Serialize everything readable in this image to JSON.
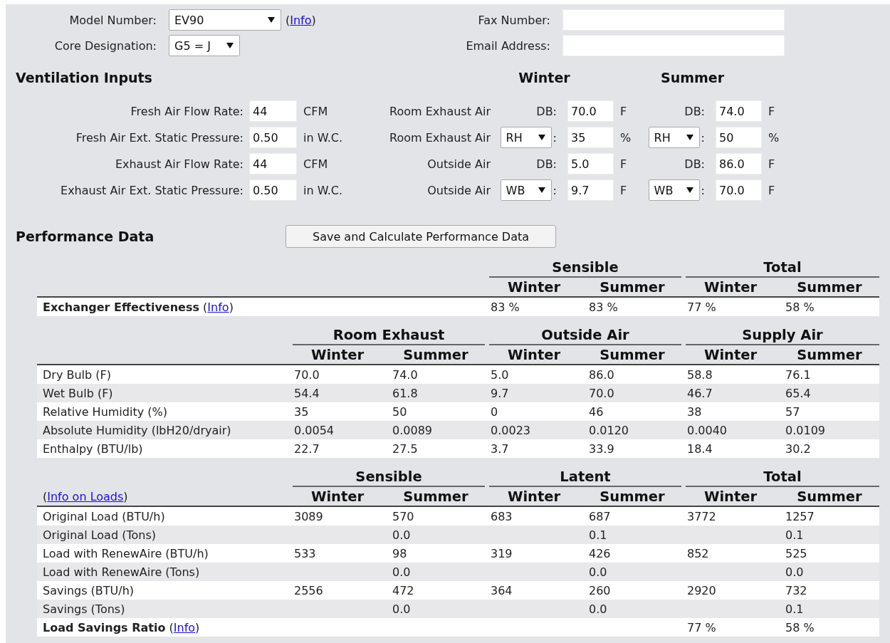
{
  "selection": {
    "model": {
      "label": "Model Number:",
      "value": "EV90",
      "info": {
        "prefix": "(",
        "text": "Info",
        "suffix": ")"
      }
    },
    "core": {
      "label": "Core Designation:",
      "value": "G5 = J"
    }
  },
  "contact": [
    {
      "label": "Fax Number:"
    },
    {
      "label": "Email Address:"
    }
  ],
  "ventilation": {
    "title": "Ventilation Inputs",
    "seasons": [
      "Winter",
      "Summer"
    ],
    "rows": [
      {
        "label": "Fresh Air Flow Rate:",
        "value": "44",
        "unit": "CFM",
        "air": "Room Exhaust Air",
        "winter": {
          "kind": "label",
          "text": "DB:",
          "value": "70.0",
          "unit": "F"
        },
        "summer": {
          "kind": "label",
          "text": "DB:",
          "value": "74.0",
          "unit": "F"
        }
      },
      {
        "label": "Fresh Air Ext. Static Pressure:",
        "value": "0.50",
        "unit": "in W.C.",
        "air": "Room Exhaust Air",
        "winter": {
          "kind": "select",
          "text": "RH",
          "suffix": ":",
          "value": "35",
          "unit": "%"
        },
        "summer": {
          "kind": "select",
          "text": "RH",
          "suffix": ":",
          "value": "50",
          "unit": "%"
        }
      },
      {
        "label": "Exhaust Air Flow Rate:",
        "value": "44",
        "unit": "CFM",
        "air": "Outside Air",
        "winter": {
          "kind": "label",
          "text": "DB:",
          "value": "5.0",
          "unit": "F"
        },
        "summer": {
          "kind": "label",
          "text": "DB:",
          "value": "86.0",
          "unit": "F"
        }
      },
      {
        "label": "Exhaust Air Ext. Static Pressure:",
        "value": "0.50",
        "unit": "in W.C.",
        "air": "Outside Air",
        "winter": {
          "kind": "select",
          "text": "WB",
          "suffix": ":",
          "value": "9.7",
          "unit": "F"
        },
        "summer": {
          "kind": "select",
          "text": "WB",
          "suffix": ":",
          "value": "70.0",
          "unit": "F"
        }
      }
    ]
  },
  "performance": {
    "title": "Performance Data",
    "button": "Save and Calculate Performance Data",
    "tables": [
      {
        "groups": [
          {
            "label": "Sensible",
            "columns": [
              "Winter",
              "Summer"
            ]
          },
          {
            "label": "Total",
            "columns": [
              "Winter",
              "Summer"
            ]
          }
        ],
        "rows": [
          {
            "label": "Exchanger Effectiveness",
            "bold": true,
            "info": {
              "prefix": "(",
              "text": "Info",
              "suffix": ")"
            },
            "values": [
              "83 %",
              "83 %",
              "77 %",
              "58 %"
            ]
          }
        ]
      },
      {
        "groups": [
          {
            "label": "Room Exhaust",
            "columns": [
              "Winter",
              "Summer"
            ]
          },
          {
            "label": "Outside Air",
            "columns": [
              "Winter",
              "Summer"
            ]
          },
          {
            "label": "Supply Air",
            "columns": [
              "Winter",
              "Summer"
            ]
          }
        ],
        "rows": [
          {
            "label": "Dry Bulb (F)",
            "bold": false,
            "values": [
              "70.0",
              "74.0",
              "5.0",
              "86.0",
              "58.8",
              "76.1"
            ]
          },
          {
            "label": "Wet Bulb (F)",
            "bold": false,
            "values": [
              "54.4",
              "61.8",
              "9.7",
              "70.0",
              "46.7",
              "65.4"
            ]
          },
          {
            "label": "Relative Humidity (%)",
            "bold": false,
            "values": [
              "35",
              "50",
              "0",
              "46",
              "38",
              "57"
            ]
          },
          {
            "label": "Absolute Humidity (lbH20/dryair)",
            "bold": false,
            "values": [
              "0.0054",
              "0.0089",
              "0.0023",
              "0.0120",
              "0.0040",
              "0.0109"
            ]
          },
          {
            "label": "Enthalpy (BTU/lb)",
            "bold": false,
            "values": [
              "22.7",
              "27.5",
              "3.7",
              "33.9",
              "18.4",
              "30.2"
            ]
          }
        ]
      },
      {
        "corner": {
          "prefix": "(",
          "text": "Info on Loads",
          "suffix": ")"
        },
        "groups": [
          {
            "label": "Sensible",
            "columns": [
              "Winter",
              "Summer"
            ]
          },
          {
            "label": "Latent",
            "columns": [
              "Winter",
              "Summer"
            ]
          },
          {
            "label": "Total",
            "columns": [
              "Winter",
              "Summer"
            ]
          }
        ],
        "rows": [
          {
            "label": "Original Load (BTU/h)",
            "bold": false,
            "values": [
              "3089",
              "570",
              "683",
              "687",
              "3772",
              "1257"
            ]
          },
          {
            "label": "Original Load (Tons)",
            "bold": false,
            "cells": [
              {
                "kind": "empty"
              },
              {
                "kind": "value",
                "text": "0.0"
              },
              {
                "kind": "empty"
              },
              {
                "kind": "value",
                "text": "0.1"
              },
              {
                "kind": "empty"
              },
              {
                "kind": "value",
                "text": "0.1"
              }
            ]
          },
          {
            "label": "Load with RenewAire (BTU/h)",
            "bold": false,
            "values": [
              "533",
              "98",
              "319",
              "426",
              "852",
              "525"
            ]
          },
          {
            "label": "Load with RenewAire (Tons)",
            "bold": false,
            "cells": [
              {
                "kind": "empty"
              },
              {
                "kind": "value",
                "text": "0.0"
              },
              {
                "kind": "empty"
              },
              {
                "kind": "value",
                "text": "0.0"
              },
              {
                "kind": "empty"
              },
              {
                "kind": "value",
                "text": "0.0"
              }
            ]
          },
          {
            "label": "Savings (BTU/h)",
            "bold": false,
            "values": [
              "2556",
              "472",
              "364",
              "260",
              "2920",
              "732"
            ]
          },
          {
            "label": "Savings (Tons)",
            "bold": false,
            "cells": [
              {
                "kind": "empty"
              },
              {
                "kind": "value",
                "text": "0.0"
              },
              {
                "kind": "empty"
              },
              {
                "kind": "value",
                "text": "0.0"
              },
              {
                "kind": "empty"
              },
              {
                "kind": "value",
                "text": "0.1"
              }
            ]
          },
          {
            "label": "Load Savings Ratio",
            "bold": true,
            "info": {
              "prefix": "(",
              "text": "Info",
              "suffix": ")"
            },
            "cells": [
              {
                "kind": "empty"
              },
              {
                "kind": "empty"
              },
              {
                "kind": "empty"
              },
              {
                "kind": "empty"
              },
              {
                "kind": "value",
                "text": "77 %"
              },
              {
                "kind": "value",
                "text": "58 %"
              }
            ]
          }
        ]
      }
    ]
  }
}
